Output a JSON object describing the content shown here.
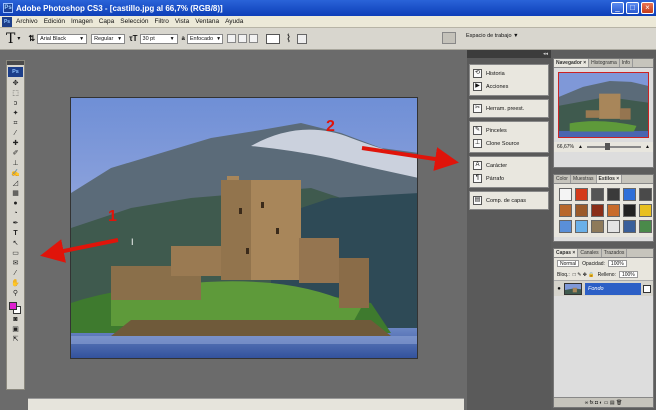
{
  "window": {
    "title": "Adobe Photoshop CS3 - [castillo.jpg al 66,7% (RGB/8)]",
    "controls": {
      "minimize": "_",
      "maximize": "□",
      "close": "×"
    }
  },
  "menubar": {
    "items": [
      "Archivo",
      "Edición",
      "Imagen",
      "Capa",
      "Selección",
      "Filtro",
      "Vista",
      "Ventana",
      "Ayuda"
    ]
  },
  "options": {
    "tool_glyph": "T",
    "font_family": "Arial Black",
    "font_style": "Regular",
    "font_size": "30 pt",
    "aa_glyph": "a",
    "antialias": "Enfocado",
    "workspace_label": "Espacio de trabajo ▼"
  },
  "dock": {
    "group1": [
      {
        "icon": "history-icon",
        "label": "Historia"
      },
      {
        "icon": "actions-icon",
        "label": "Acciones"
      }
    ],
    "group2": [
      {
        "icon": "tool-presets-icon",
        "label": "Herram. preest."
      }
    ],
    "group3": [
      {
        "icon": "brushes-icon",
        "label": "Pinceles"
      },
      {
        "icon": "clone-source-icon",
        "label": "Clone Source"
      }
    ],
    "group4": [
      {
        "icon": "character-icon",
        "label": "Carácter"
      },
      {
        "icon": "paragraph-icon",
        "label": "Párrafo"
      }
    ],
    "group5": [
      {
        "icon": "layer-comps-icon",
        "label": "Comp. de capas"
      }
    ]
  },
  "navigator_panel": {
    "tabs": [
      "Navegador ×",
      "Histograma",
      "Info"
    ],
    "zoom": "66,67%"
  },
  "swatches_panel": {
    "tabs": [
      "Color",
      "Muestras",
      "Estilos ×"
    ],
    "colors": [
      "#f4f4f4",
      "#d43a1a",
      "#555555",
      "#3a3a3a",
      "#2f6fd8",
      "#4a4a4a",
      "#b8672a",
      "#9a5a2a",
      "#8a2e18",
      "#c86b2a",
      "#222222",
      "#e8c020",
      "#5a8fd8",
      "#6ab0e8",
      "#8e7a5a",
      "#e4e4e4",
      "#3a5f9a",
      "#4a8a4a"
    ]
  },
  "layers_panel": {
    "tabs": [
      "Capas ×",
      "Canales",
      "Trazados"
    ],
    "blend": "Normal",
    "opacity_label": "Opacidad:",
    "opacity": "100%",
    "lock_label": "Bloq.:",
    "fill_label": "Relleno:",
    "fill": "100%",
    "layer_name": "Fondo",
    "footer": "∞  fx  ◘  ◐  ▭  ▤  🗑"
  },
  "annotations": [
    {
      "number": "1",
      "color": "#e0140a"
    },
    {
      "number": "2",
      "color": "#e0140a"
    }
  ],
  "tools": [
    "▸✥",
    "⬚",
    "ↄ",
    "✎",
    "⌗",
    "⌖",
    "✐",
    "✍",
    "⊕",
    "⊖",
    "◿",
    "✦",
    "◔",
    "●",
    "⊙",
    "⚲",
    "T",
    "↖",
    "▭",
    "✋",
    "✎",
    "⊕",
    "✋",
    "⚲"
  ]
}
